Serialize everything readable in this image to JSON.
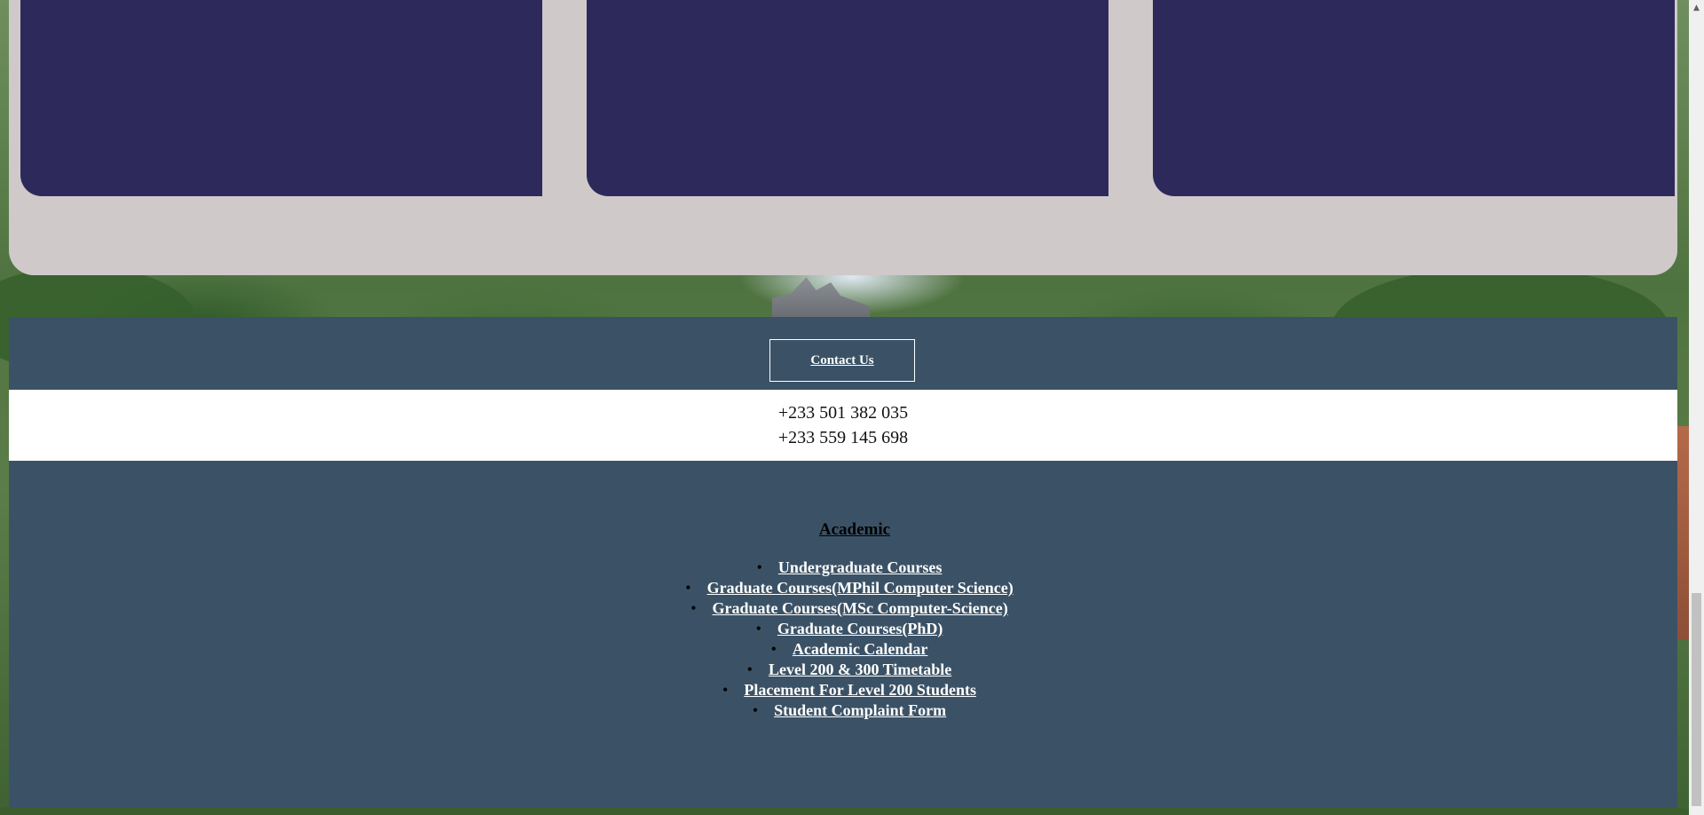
{
  "contact": {
    "button_label": "Contact Us",
    "phones": [
      "+233 501 382 035",
      "+233 559 145 698"
    ]
  },
  "academic": {
    "title": "Academic",
    "links": [
      "Undergraduate Courses",
      "Graduate Courses(MPhil Computer Science)",
      "Graduate Courses(MSc Computer-Science)",
      "Graduate Courses(PhD)",
      "Academic Calendar",
      "Level 200 & 300 Timetable",
      "Placement For Level 200 Students",
      "Student Complaint Form"
    ]
  },
  "colors": {
    "card": "#2d2a5b",
    "panel": "#cfc9ca",
    "footer": "#3b5266",
    "link": "#ffffff"
  },
  "icons": {
    "bullet": "•",
    "scroll_up": "▲"
  }
}
